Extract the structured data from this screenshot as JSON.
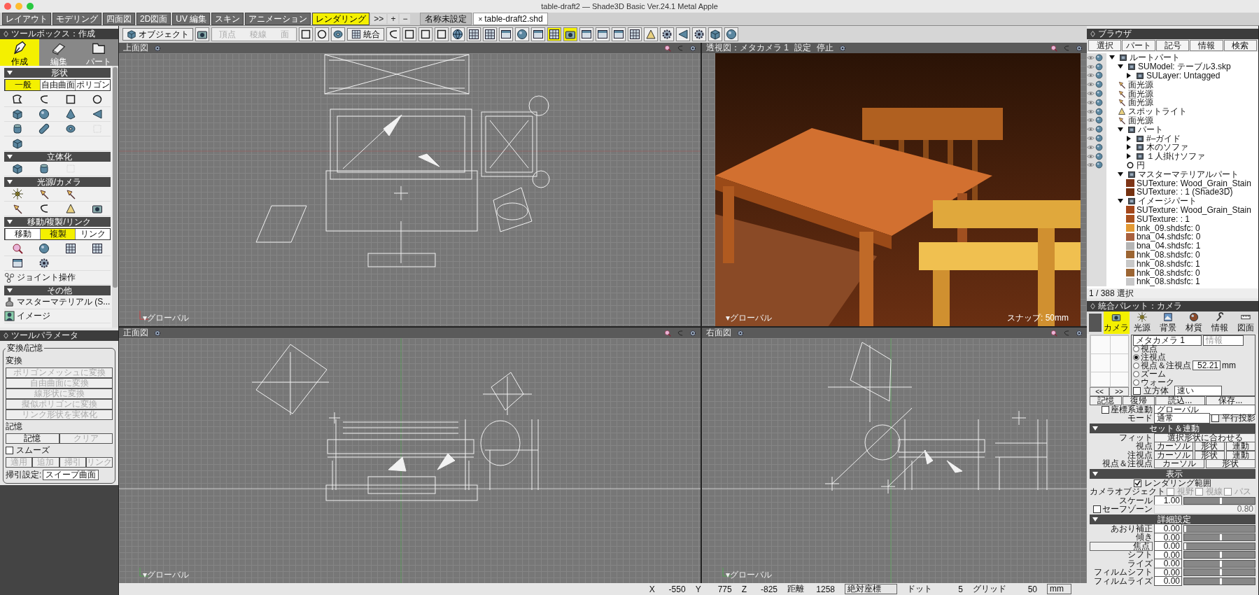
{
  "window": {
    "title": "table-draft2 — Shade3D Basic Ver.24.1 Metal Apple"
  },
  "mode_tabs": [
    {
      "label": "レイアウト",
      "selected": false
    },
    {
      "label": "モデリング",
      "selected": false
    },
    {
      "label": "四面図",
      "selected": false
    },
    {
      "label": "2D図面",
      "selected": false
    },
    {
      "label": "UV 編集",
      "selected": false
    },
    {
      "label": "スキン",
      "selected": false
    },
    {
      "label": "アニメーション",
      "selected": false
    },
    {
      "label": "レンダリング",
      "selected": true
    }
  ],
  "tab_controls": [
    ">>",
    "+",
    "−"
  ],
  "document_tabs": [
    {
      "label": "名称未設定",
      "selected": false
    },
    {
      "label": "table-draft2.shd",
      "selected": true,
      "close": "×"
    }
  ],
  "toolbar": {
    "object_menu": "オブジェクト",
    "edit_modes": [
      {
        "label": "頂点",
        "disabled": true
      },
      {
        "label": "稜線",
        "disabled": true
      },
      {
        "label": "面",
        "disabled": true
      }
    ],
    "merge": "統合",
    "icon_buttons": [
      {
        "selected": false
      },
      {
        "selected": false
      },
      {
        "selected": false
      },
      {
        "selected": false
      },
      {
        "selected": false
      },
      {
        "selected": false
      },
      {
        "selected": false
      },
      {
        "selected": false
      },
      {
        "selected": false
      },
      {
        "selected": false
      },
      {
        "selected": true
      },
      {
        "selected": true
      },
      {
        "selected": false
      },
      {
        "selected": false
      },
      {
        "selected": false
      },
      {
        "selected": false
      },
      {
        "selected": false
      },
      {
        "selected": false
      },
      {
        "selected": false
      },
      {
        "selected": false
      },
      {
        "selected": false
      },
      {
        "selected": false
      }
    ]
  },
  "toolbox": {
    "title": "ツールボックス：作成",
    "tabs": [
      {
        "label": "作成",
        "selected": true
      },
      {
        "label": "編集",
        "selected": false
      },
      {
        "label": "パート",
        "selected": false
      }
    ],
    "sections": [
      {
        "title": "形状",
        "expanded": true,
        "segments": [
          {
            "label": "一般",
            "selected": true
          },
          {
            "label": "自由曲面",
            "selected": false
          },
          {
            "label": "ポリゴン",
            "selected": false
          }
        ]
      },
      {
        "title": "立体化",
        "expanded": true
      },
      {
        "title": "光源/カメラ",
        "expanded": true
      },
      {
        "title": "移動/複製/リンク",
        "expanded": true,
        "segments": [
          {
            "label": "移動",
            "selected": false
          },
          {
            "label": "複製",
            "selected": true
          },
          {
            "label": "リンク",
            "selected": false
          }
        ],
        "items": [
          "ジョイント操作"
        ]
      },
      {
        "title": "その他",
        "expanded": true,
        "items": [
          "マスターマテリアル (S...",
          "イメージ"
        ]
      }
    ]
  },
  "tool_parameters": {
    "title": "ツールパラメータ",
    "group": "変換/記憶",
    "convert_label": "変換",
    "convert_buttons": [
      {
        "label": "ポリゴンメッシュに変換",
        "disabled": true
      },
      {
        "label": "自由曲面に変換",
        "disabled": true
      },
      {
        "label": "線形状に変換",
        "disabled": true
      },
      {
        "label": "擬似ポリゴンに変換",
        "disabled": true
      },
      {
        "label": "リンク形状を実体化",
        "disabled": true
      }
    ],
    "memory_label": "記憶",
    "memory_buttons": [
      {
        "label": "記憶",
        "disabled": false
      },
      {
        "label": "クリア",
        "disabled": true
      }
    ],
    "smooth": {
      "label": "スムーズ",
      "checked": false
    },
    "smooth_buttons": [
      {
        "label": "適用",
        "disabled": true
      },
      {
        "label": "追加",
        "disabled": true
      },
      {
        "label": "掃引",
        "disabled": true
      },
      {
        "label": "リンク",
        "disabled": true
      }
    ],
    "sweep": {
      "label": "掃引設定:",
      "value": "スイープ曲面"
    }
  },
  "viewports": [
    {
      "kind": "top",
      "title": "上面図",
      "footer": "▾グローバル"
    },
    {
      "kind": "perspective",
      "title": "透視図：メタカメラ 1",
      "menus": [
        "設定",
        "停止"
      ],
      "footer": "▾グローバル",
      "snap": "スナップ: 50mm"
    },
    {
      "kind": "front",
      "title": "正面図",
      "footer": "▾グローバル"
    },
    {
      "kind": "right",
      "title": "右面図",
      "footer": "▾グローバル"
    }
  ],
  "browser": {
    "title": "ブラウザ",
    "menus": [
      "選択",
      "パート",
      "記号",
      "情報",
      "検索"
    ],
    "tree": [
      {
        "label": "ルートパート",
        "kind": "part",
        "visibility_icons": true,
        "expanded": true,
        "children": [
          {
            "label": "SUModel: テーブル3.skp",
            "kind": "part",
            "visibility_icons": true,
            "expanded": true,
            "children": [
              {
                "label": "SULayer: Untagged",
                "kind": "part",
                "visibility_icons": true,
                "expanded": false
              }
            ]
          },
          {
            "label": "面光源",
            "kind": "light",
            "visibility_icons": true
          },
          {
            "label": "面光源",
            "kind": "light",
            "visibility_icons": true
          },
          {
            "label": "面光源",
            "kind": "light",
            "visibility_icons": true
          },
          {
            "label": "スポットライト",
            "kind": "spot",
            "visibility_icons": true
          },
          {
            "label": "面光源",
            "kind": "light",
            "visibility_icons": true
          },
          {
            "label": "パート",
            "kind": "part",
            "visibility_icons": true,
            "expanded": true,
            "children": [
              {
                "label": "#–ガイド",
                "kind": "part",
                "visibility_icons": true,
                "expanded": false
              },
              {
                "label": "木のソファ",
                "kind": "part",
                "visibility_icons": true,
                "expanded": false
              },
              {
                "label": "１人掛けソファ",
                "kind": "part",
                "visibility_icons": true,
                "expanded": false
              },
              {
                "label": "円",
                "kind": "circle",
                "visibility_icons": true
              }
            ]
          },
          {
            "label": "マスターマテリアルパート",
            "kind": "part",
            "visibility_icons": false,
            "expanded": true,
            "children": [
              {
                "label": "SUTexture: Wood_Grain_Stain",
                "kind": "texture",
                "visibility_icons": false,
                "color": "#7e3416"
              },
              {
                "label": "SUTexture: : 1 (Shade3D)",
                "kind": "texture",
                "visibility_icons": false,
                "color": "#74300f"
              }
            ]
          },
          {
            "label": "イメージパート",
            "kind": "part",
            "visibility_icons": false,
            "expanded": true,
            "children": [
              {
                "label": "SUTexture: Wood_Grain_Stain",
                "kind": "texture",
                "visibility_icons": false,
                "color": "#a4471b"
              },
              {
                "label": "SUTexture: : 1",
                "kind": "texture",
                "visibility_icons": false,
                "color": "#a9511f"
              },
              {
                "label": "hnk_09.shdsfc: 0",
                "kind": "texture",
                "visibility_icons": false,
                "color": "#e39a34"
              },
              {
                "label": "bna_04.shdsfc: 0",
                "kind": "texture",
                "visibility_icons": false,
                "color": "#a8603e"
              },
              {
                "label": "bna_04.shdsfc: 1",
                "kind": "texture",
                "visibility_icons": false,
                "color": "#b4b4b4"
              },
              {
                "label": "hnk_08.shdsfc: 0",
                "kind": "texture",
                "visibility_icons": false,
                "color": "#9c6532"
              },
              {
                "label": "hnk_08.shdsfc: 1",
                "kind": "texture",
                "visibility_icons": false,
                "color": "#c8c8c8"
              },
              {
                "label": "hnk_08.shdsfc: 0",
                "kind": "texture",
                "visibility_icons": false,
                "color": "#9c6533"
              },
              {
                "label": "hnk_08.shdsfc: 1",
                "kind": "texture",
                "visibility_icons": false,
                "color": "#c8c8c9"
              }
            ]
          }
        ]
      }
    ],
    "status": "1 / 388 選択"
  },
  "palette": {
    "title": "統合パレット：カメラ",
    "tabs": [
      {
        "label": "カメラ",
        "selected": true
      },
      {
        "label": "光源",
        "selected": false
      },
      {
        "label": "背景",
        "selected": false
      },
      {
        "label": "材質",
        "selected": false
      },
      {
        "label": "情報",
        "selected": false
      },
      {
        "label": "図面",
        "selected": false
      }
    ],
    "camera": {
      "name": "メタカメラ 1",
      "info": "情報",
      "nav": [
        "<<",
        ">>"
      ],
      "modes": [
        {
          "label": "視点",
          "selected": false
        },
        {
          "label": "注視点",
          "selected": true
        },
        {
          "label": "視点＆注視点",
          "selected": false
        },
        {
          "label": "ズーム",
          "selected": false
        },
        {
          "label": "ウォーク",
          "selected": false
        }
      ],
      "zoom_value": "52.21",
      "zoom_unit": "mm",
      "cube": {
        "label": "立方体",
        "checked": false
      },
      "speed": "速い"
    },
    "buttons": [
      {
        "label": "記憶",
        "kind": "menu"
      },
      {
        "label": "復帰",
        "kind": "menu"
      },
      {
        "label": "読込...",
        "kind": "button"
      },
      {
        "label": "保存...",
        "kind": "button"
      }
    ],
    "coord_link": {
      "label": "座標系連動",
      "checked": false,
      "value": "グローバル"
    },
    "mode": {
      "label": "モード",
      "value": "通常"
    },
    "parallel": {
      "label": "平行投影",
      "checked": false
    },
    "set_link": {
      "title": "セット＆連動",
      "expanded": true,
      "fit_label": "フィット",
      "fit_button": "選択形状に合わせる",
      "rows": [
        {
          "label": "視点",
          "buttons": [
            "カーソル",
            "形状",
            "連動"
          ]
        },
        {
          "label": "注視点",
          "buttons": [
            "カーソル",
            "形状",
            "連動"
          ]
        },
        {
          "label": "視点＆注視点",
          "buttons": [
            "カーソル",
            "形状"
          ]
        }
      ]
    },
    "display": {
      "title": "表示",
      "expanded": true,
      "render_range": {
        "label": "レンダリング範囲",
        "checked": true
      },
      "camera_object_label": "カメラオブジェクト",
      "camera_object_options": [
        {
          "label": "視野",
          "checked": false
        },
        {
          "label": "視線",
          "checked": false
        },
        {
          "label": "パス",
          "checked": false
        }
      ],
      "scale": {
        "label": "スケール",
        "value": "1.00",
        "level": 0.5
      },
      "safe_zone": {
        "label": "セーフゾーン",
        "checked": false,
        "value": "0.80"
      }
    },
    "details": {
      "title": "詳細設定",
      "expanded": true,
      "rows": [
        {
          "label": "あおり補正",
          "kind": "label",
          "value": "0.00",
          "level": 0
        },
        {
          "label": "傾き",
          "kind": "label",
          "value": "0.00",
          "level": 0.5
        },
        {
          "label": "焦点",
          "kind": "button",
          "value": "0.00",
          "level": 0
        },
        {
          "label": "シフト",
          "kind": "label",
          "value": "0.00",
          "level": 0.5
        },
        {
          "label": "ライズ",
          "kind": "label",
          "value": "0.00",
          "level": 0.5
        },
        {
          "label": "フィルムシフト",
          "kind": "label",
          "value": "0.00",
          "level": 0.5
        },
        {
          "label": "フィルムライズ",
          "kind": "label",
          "value": "0.00",
          "level": 0.5
        }
      ]
    }
  },
  "status_bar": {
    "coordinates": [
      {
        "label": "X",
        "value": "-550"
      },
      {
        "label": "Y",
        "value": "775"
      },
      {
        "label": "Z",
        "value": "-825"
      },
      {
        "label": "距離",
        "value": "1258"
      }
    ],
    "coord_mode": "絶対座標",
    "dot": {
      "label": "ドット",
      "value": "5"
    },
    "grid": {
      "label": "グリッド",
      "value": "50"
    },
    "unit": "mm"
  }
}
